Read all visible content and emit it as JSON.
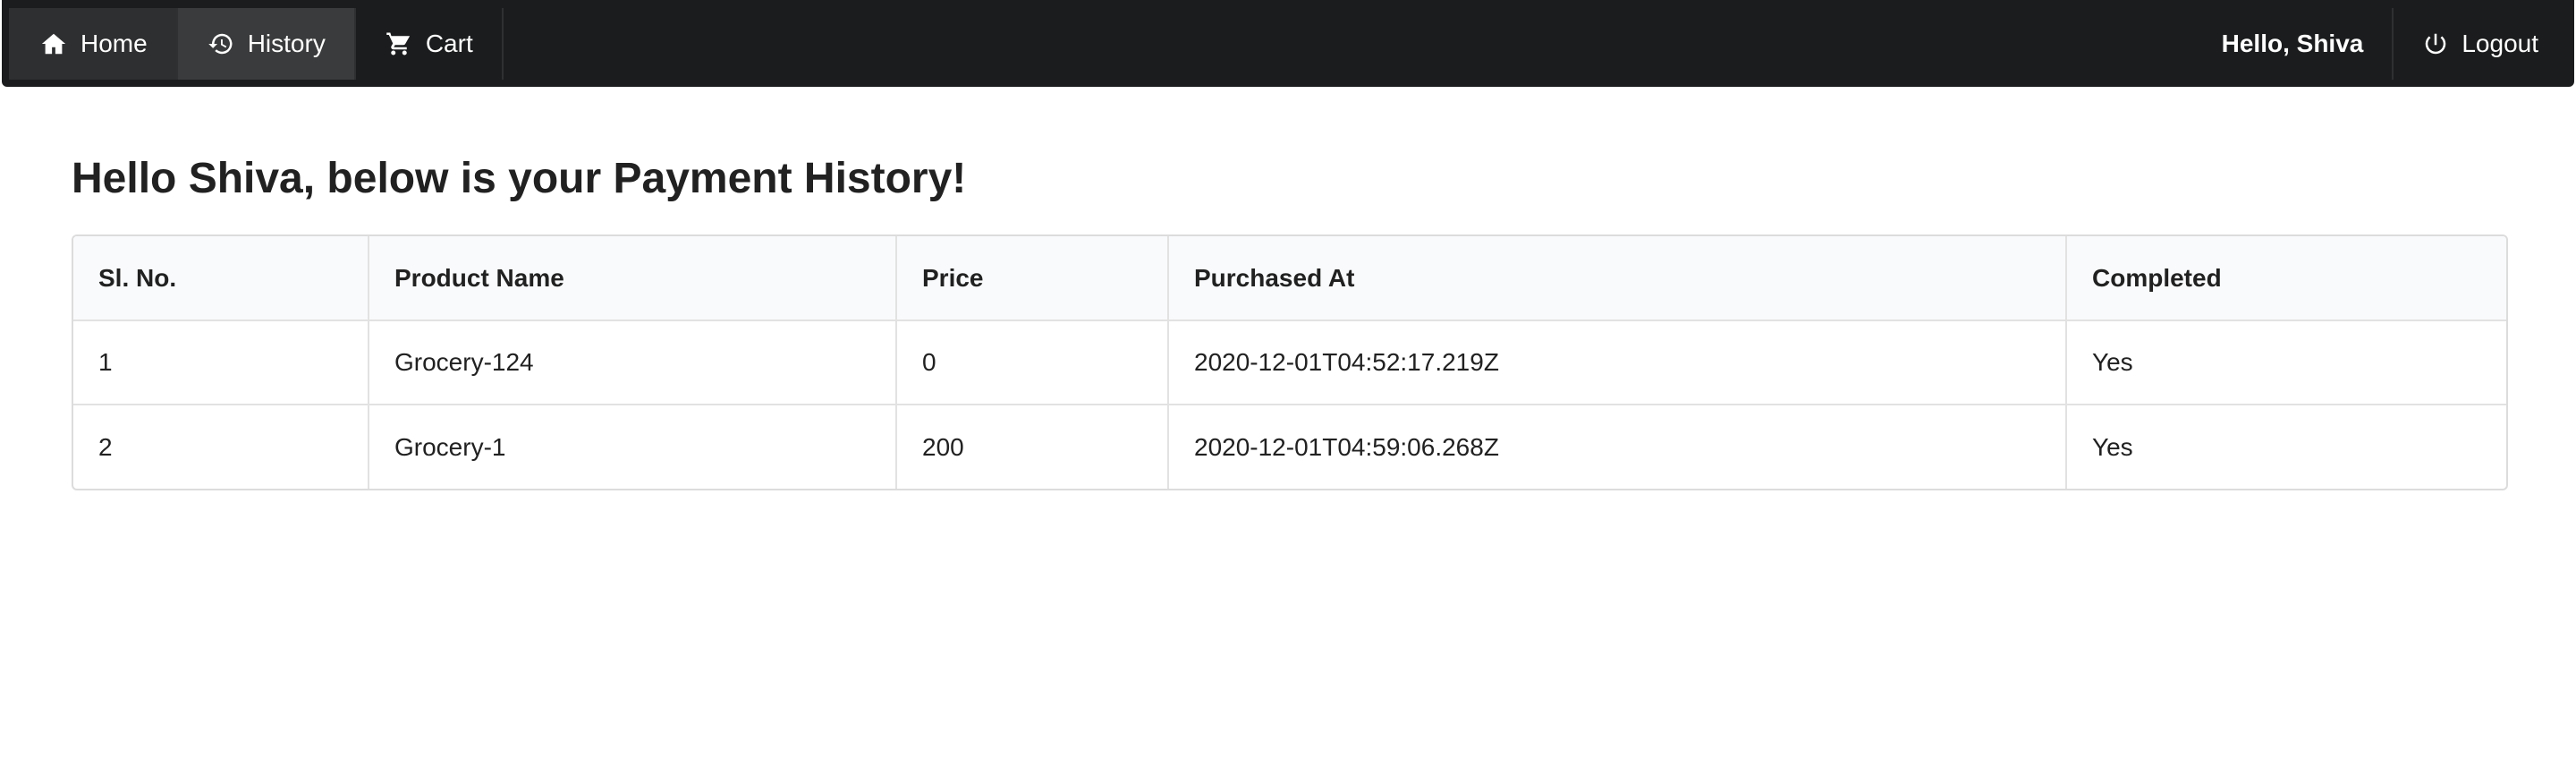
{
  "nav": {
    "home_label": "Home",
    "history_label": "History",
    "cart_label": "Cart",
    "greeting": "Hello, Shiva",
    "logout_label": "Logout",
    "icons": [
      "home-icon",
      "history-icon",
      "cart-icon",
      "power-icon"
    ]
  },
  "main": {
    "title": "Hello Shiva, below is your Payment History!",
    "table": {
      "headers": [
        "Sl. No.",
        "Product Name",
        "Price",
        "Purchased At",
        "Completed"
      ],
      "rows": [
        [
          "1",
          "Grocery-124",
          "0",
          "2020-12-01T04:52:17.219Z",
          "Yes"
        ],
        [
          "2",
          "Grocery-1",
          "200",
          "2020-12-01T04:59:06.268Z",
          "Yes"
        ]
      ]
    }
  },
  "colors": {
    "navbar_bg": "#1b1c1d",
    "active_item_bg": "#3a3b3c",
    "table_header_bg": "#f9fafb"
  }
}
